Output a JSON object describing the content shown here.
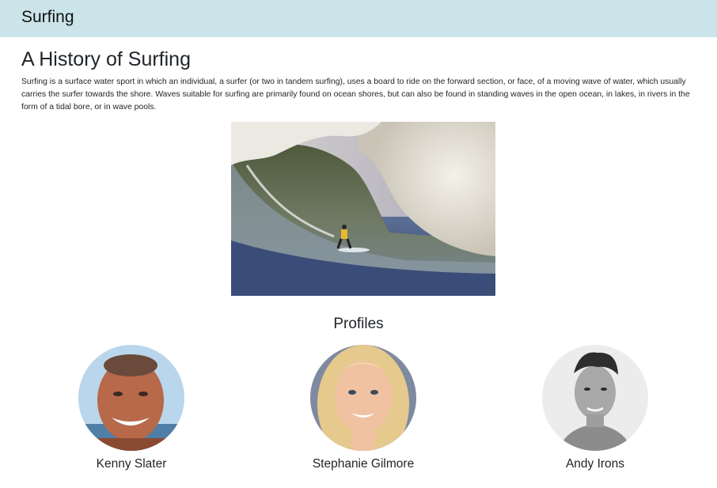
{
  "navbar": {
    "brand": "Surfing"
  },
  "main": {
    "title": "A History of Surfing",
    "intro": "Surfing is a surface water sport in which an individual, a surfer (or two in tandem surfing), uses a board to ride on the forward section, or face, of a moving wave of water, which usually carries the surfer towards the shore. Waves suitable for surfing are primarily found on ocean shores, but can also be found in standing waves in the open ocean, in lakes, in rivers in the form of a tidal bore, or in wave pools."
  },
  "profiles": {
    "heading": "Profiles",
    "items": [
      {
        "name": "Kenny Slater"
      },
      {
        "name": "Stephanie Gilmore"
      },
      {
        "name": "Andy Irons"
      }
    ]
  },
  "colors": {
    "navbar_bg": "#cbe4ea",
    "text": "#212529"
  }
}
